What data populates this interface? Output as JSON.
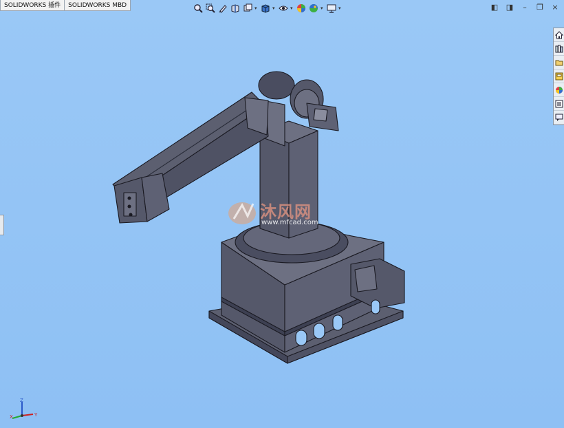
{
  "tabs": [
    {
      "label": "SOLIDWORKS 插件"
    },
    {
      "label": "SOLIDWORKS MBD"
    }
  ],
  "heads_up_toolbar": [
    "zoom-to-fit-icon",
    "zoom-to-area-icon",
    "previous-view-icon",
    "section-view-icon",
    "view-orientation-icon",
    "display-style-icon",
    "hide-show-items-icon",
    "edit-appearance-icon",
    "apply-scene-icon",
    "view-settings-icon"
  ],
  "task_pane": [
    "home-icon",
    "design-library-icon",
    "file-explorer-icon",
    "view-palette-icon",
    "appearances-icon",
    "custom-properties-icon",
    "solidworks-forum-icon"
  ],
  "watermark": {
    "brand": "沐风网",
    "url": "www.mfcad.com"
  },
  "triad": {
    "x": "X",
    "y": "Y",
    "z": "Z"
  },
  "colors": {
    "viewport": "#8ec0f4",
    "model": "#5c5f70",
    "edges": "#1a1a22"
  }
}
